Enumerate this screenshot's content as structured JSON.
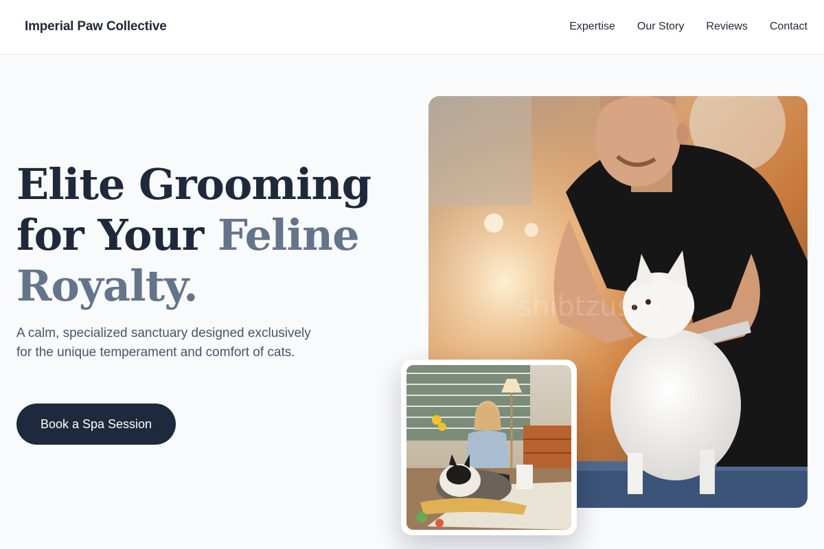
{
  "brand": {
    "name": "Imperial Paw Collective"
  },
  "nav": {
    "items": [
      "Expertise",
      "Our Story",
      "Reviews",
      "Contact"
    ]
  },
  "hero": {
    "title_line1": "Elite Grooming",
    "title_line2_start": "for Your ",
    "title_line2_accent": "Feline",
    "title_line3": "Royalty.",
    "subtitle": "A calm, specialized sanctuary designed exclusively for the unique temperament and comfort of cats.",
    "cta_label": "Book a Spa Session"
  },
  "colors": {
    "primary": "#1e293b",
    "accent": "#64748b",
    "background": "#f8fafc"
  }
}
